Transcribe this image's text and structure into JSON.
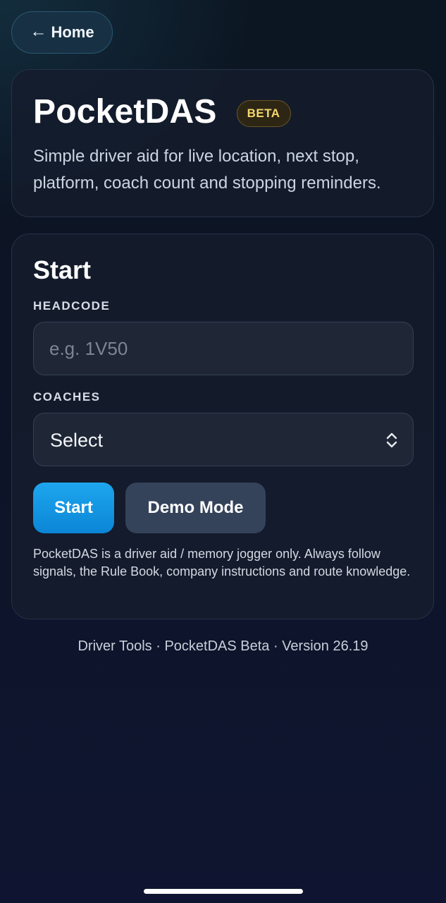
{
  "nav": {
    "home_label": "Home",
    "home_icon": "arrow-left-icon"
  },
  "hero": {
    "title": "PocketDAS",
    "badge": "BETA",
    "subtitle": "Simple driver aid for live location, next stop, platform, coach count and stopping reminders."
  },
  "start": {
    "title": "Start",
    "headcode": {
      "label": "HEADCODE",
      "value": "",
      "placeholder": "e.g. 1V50"
    },
    "coaches": {
      "label": "COACHES",
      "selected": "Select",
      "icon": "chevron-up-down-icon"
    },
    "start_label": "Start",
    "demo_label": "Demo Mode",
    "disclaimer": "PocketDAS is a driver aid / memory jogger only. Always follow signals, the Rule Book, company instructions and route knowledge."
  },
  "footer": {
    "text": "Driver Tools · PocketDAS Beta · Version 26.19"
  },
  "colors": {
    "accent": "#1499e3",
    "beta_badge_text": "#f5d76e",
    "background": "#0e1528",
    "card": "#151c2c"
  }
}
